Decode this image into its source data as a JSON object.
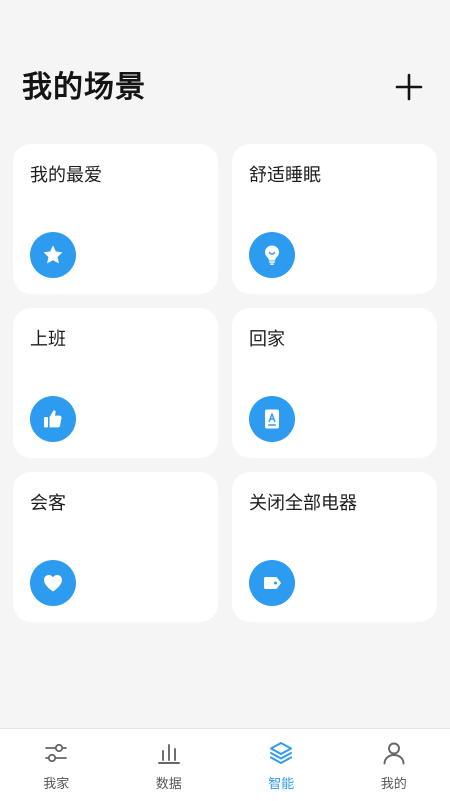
{
  "header": {
    "title": "我的场景",
    "add_icon": "plus-icon"
  },
  "scenes": [
    {
      "label": "我的最爱",
      "icon": "star-icon"
    },
    {
      "label": "舒适睡眠",
      "icon": "lightbulb-icon"
    },
    {
      "label": "上班",
      "icon": "thumbs-up-icon"
    },
    {
      "label": "回家",
      "icon": "book-icon"
    },
    {
      "label": "会客",
      "icon": "heart-icon"
    },
    {
      "label": "关闭全部电器",
      "icon": "tag-icon"
    }
  ],
  "tabbar": {
    "items": [
      {
        "label": "我家",
        "icon": "sliders-icon",
        "active": false
      },
      {
        "label": "数据",
        "icon": "bar-chart-icon",
        "active": false
      },
      {
        "label": "智能",
        "icon": "layers-icon",
        "active": true
      },
      {
        "label": "我的",
        "icon": "user-icon",
        "active": false
      }
    ]
  },
  "colors": {
    "accent": "#2d9bf0",
    "background": "#f5f5f5",
    "card": "#ffffff",
    "text": "#1a1a1a"
  }
}
